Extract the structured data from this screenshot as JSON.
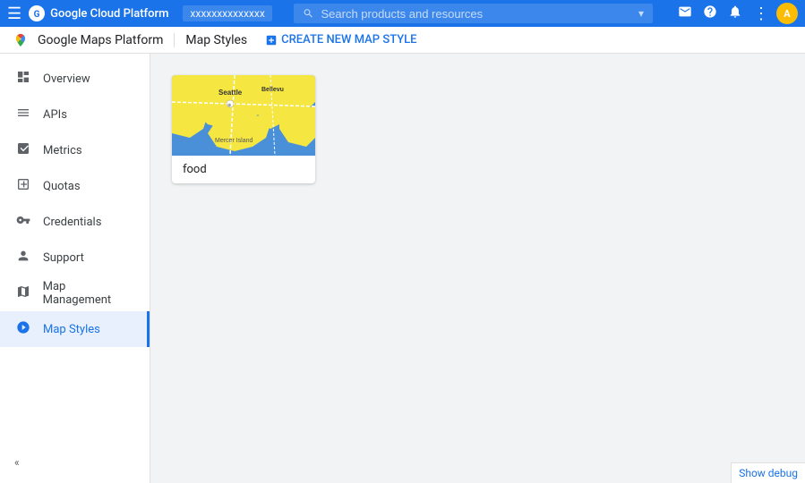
{
  "topbar": {
    "menu_label": "☰",
    "title": "Google Cloud Platform",
    "project": "xxxxxxxxxxxxxx",
    "search_placeholder": "Search products and resources",
    "dropdown_icon": "▾",
    "email_icon": "✉",
    "help_icon": "?",
    "bell_icon": "🔔",
    "more_icon": "⋮",
    "avatar_text": "A"
  },
  "sub_topbar": {
    "title": "Google Maps Platform",
    "section": "Map Styles",
    "action_label": "CREATE NEW MAP STYLE",
    "action_icon": "+"
  },
  "sidebar": {
    "items": [
      {
        "id": "overview",
        "label": "Overview",
        "icon": "⊙"
      },
      {
        "id": "apis",
        "label": "APIs",
        "icon": "≡"
      },
      {
        "id": "metrics",
        "label": "Metrics",
        "icon": "▦"
      },
      {
        "id": "quotas",
        "label": "Quotas",
        "icon": "▣"
      },
      {
        "id": "credentials",
        "label": "Credentials",
        "icon": "⚿"
      },
      {
        "id": "support",
        "label": "Support",
        "icon": "👤"
      },
      {
        "id": "map-management",
        "label": "Map Management",
        "icon": "▤"
      },
      {
        "id": "map-styles",
        "label": "Map Styles",
        "icon": "◎",
        "active": true
      }
    ],
    "collapse_icon": "«"
  },
  "main": {
    "card": {
      "label": "food"
    }
  },
  "footer": {
    "debug_label": "Show debug"
  }
}
